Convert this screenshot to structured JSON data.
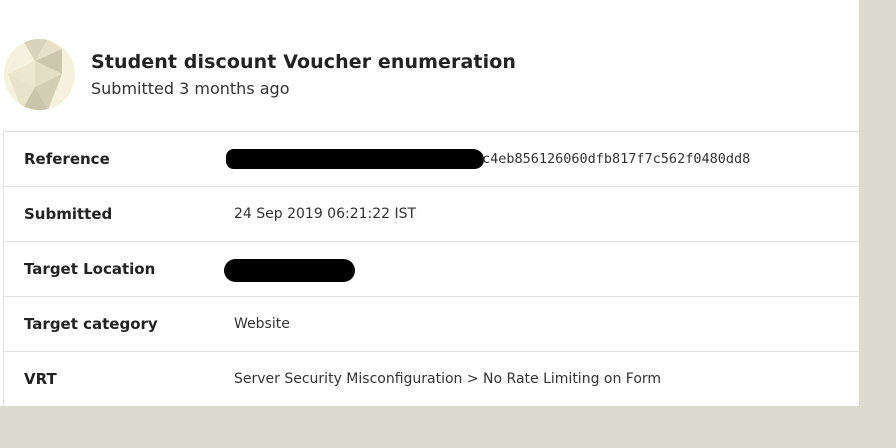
{
  "report": {
    "title": "Student discount Voucher enumeration",
    "submitted_relative": "Submitted 3 months ago"
  },
  "details": {
    "reference": {
      "label": "Reference",
      "value_visible": "c4eb856126060dfb817f7c562f0480dd8"
    },
    "submitted": {
      "label": "Submitted",
      "value": "24 Sep 2019 06:21:22 IST"
    },
    "target_location": {
      "label": "Target Location"
    },
    "target_category": {
      "label": "Target category",
      "value": "Website"
    },
    "vrt": {
      "label": "VRT",
      "value": "Server Security Misconfiguration > No Rate Limiting on Form"
    }
  },
  "colors": {
    "page_background": "#dcdbd0",
    "panel_background": "#ffffff",
    "border": "#e2e2e2",
    "redaction": "#000000"
  }
}
